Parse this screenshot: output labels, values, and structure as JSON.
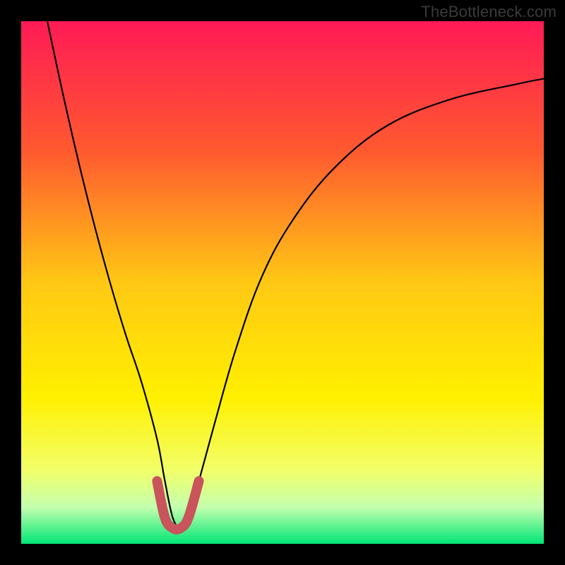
{
  "watermark": "TheBottleneck.com",
  "chart_data": {
    "type": "line",
    "title": "",
    "xlabel": "",
    "ylabel": "",
    "xlim": [
      0,
      100
    ],
    "ylim": [
      0,
      100
    ],
    "gradient_stops": [
      {
        "offset": 0,
        "color": "#ff1a55"
      },
      {
        "offset": 25,
        "color": "#ff5a2f"
      },
      {
        "offset": 50,
        "color": "#ffc814"
      },
      {
        "offset": 72,
        "color": "#fff000"
      },
      {
        "offset": 86,
        "color": "#f2ff6a"
      },
      {
        "offset": 93,
        "color": "#c4ffae"
      },
      {
        "offset": 100,
        "color": "#00e676"
      }
    ],
    "series": [
      {
        "name": "bottleneck-curve",
        "color": "#000000",
        "x": [
          5,
          8,
          11,
          14,
          17,
          20,
          23,
          26,
          27.5,
          29,
          30.5,
          32,
          34,
          37,
          41,
          46,
          52,
          60,
          70,
          82,
          95,
          100
        ],
        "y": [
          100,
          86,
          73,
          61,
          50,
          40,
          31,
          20,
          12,
          5,
          3,
          5,
          12,
          23,
          37,
          51,
          62,
          72,
          80,
          85,
          88,
          89
        ]
      },
      {
        "name": "bottleneck-highlight",
        "color": "#c9545b",
        "x": [
          26,
          27.5,
          29,
          30.5,
          32,
          34
        ],
        "y": [
          12,
          5,
          3,
          3,
          5,
          12
        ]
      }
    ]
  }
}
